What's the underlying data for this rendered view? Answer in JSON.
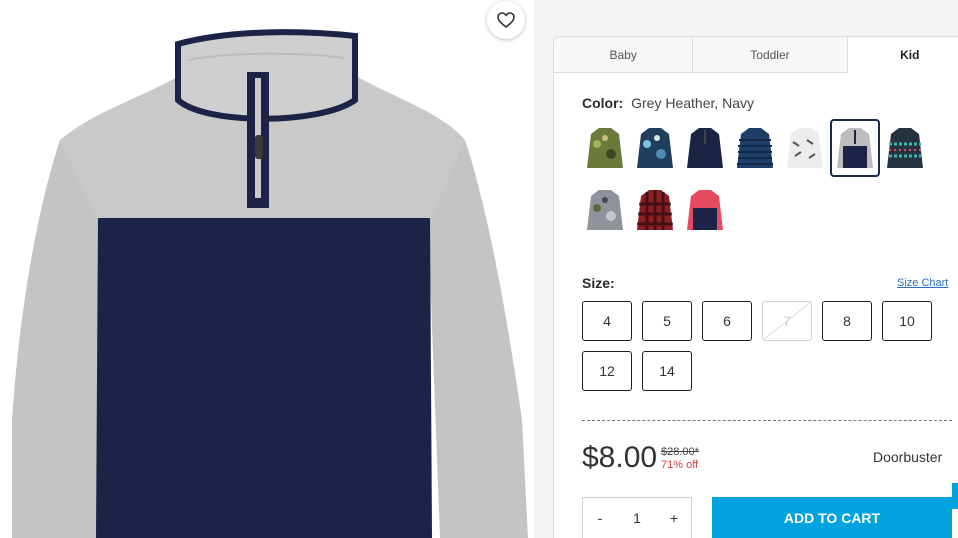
{
  "favorite": {
    "icon": "heart-icon"
  },
  "tabs": [
    "Baby",
    "Toddler",
    "Kid"
  ],
  "active_tab": "Kid",
  "color": {
    "label": "Color:",
    "value": "Grey Heather, Navy"
  },
  "swatches": [
    {
      "name": "green camo pullover",
      "color": "#6b7a3a",
      "selected": false
    },
    {
      "name": "blue camo pullover",
      "color": "#3a6d8c",
      "selected": false
    },
    {
      "name": "navy pullover",
      "color": "#1c2444",
      "selected": false
    },
    {
      "name": "navy stripe pullover",
      "color": "#1f3f6b",
      "selected": false
    },
    {
      "name": "white print pullover",
      "color": "#e6e6e6",
      "selected": false
    },
    {
      "name": "grey navy pullover",
      "color": "#b9b9b9",
      "selected": true
    },
    {
      "name": "fair isle pullover",
      "color": "#25323f",
      "selected": false
    },
    {
      "name": "grey camo pullover",
      "color": "#8e9499",
      "selected": false
    },
    {
      "name": "red buffalo check pullover",
      "color": "#8b1d24",
      "selected": false
    },
    {
      "name": "pink navy pullover",
      "color": "#e64a5f",
      "selected": false
    }
  ],
  "size": {
    "label": "Size:",
    "chart_link": "Size Chart",
    "options": [
      {
        "label": "4",
        "available": true
      },
      {
        "label": "5",
        "available": true
      },
      {
        "label": "6",
        "available": true
      },
      {
        "label": "7",
        "available": false
      },
      {
        "label": "8",
        "available": true
      },
      {
        "label": "10",
        "available": true
      },
      {
        "label": "12",
        "available": true
      },
      {
        "label": "14",
        "available": true
      }
    ]
  },
  "price": {
    "current": "$8.00",
    "original": "$28.00*",
    "discount": "71% off",
    "badge": "Doorbuster"
  },
  "quantity": {
    "minus": "-",
    "value": "1",
    "plus": "+"
  },
  "add_to_cart": "ADD TO CART",
  "colors": {
    "accent": "#00a3dd",
    "navy": "#1b2b4a",
    "sale": "#d63b3b",
    "link": "#2b6cc4"
  }
}
